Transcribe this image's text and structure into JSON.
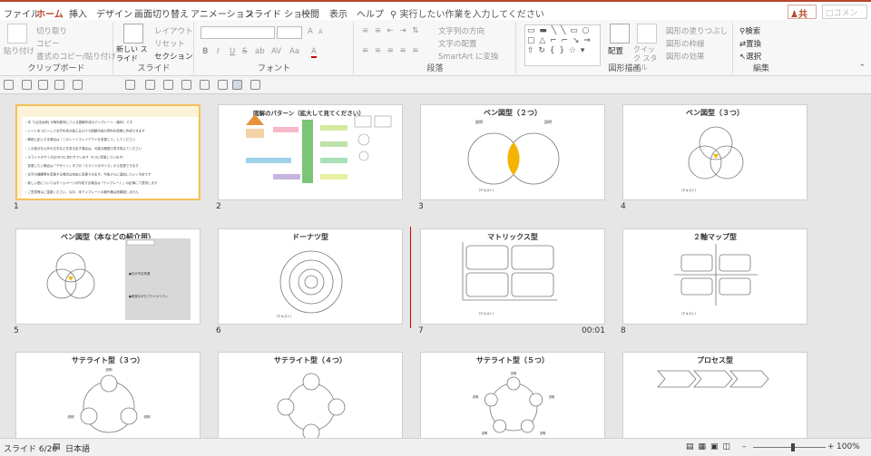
{
  "tabs": [
    {
      "name": "tab-file",
      "label": "ファイル"
    },
    {
      "name": "tab-home",
      "label": "ホーム",
      "active": true
    },
    {
      "name": "tab-insert",
      "label": "挿入"
    },
    {
      "name": "tab-design",
      "label": "デザイン"
    },
    {
      "name": "tab-transitions",
      "label": "画面切り替え"
    },
    {
      "name": "tab-animations",
      "label": "アニメーション"
    },
    {
      "name": "tab-slideshow",
      "label": "スライド ショー"
    },
    {
      "name": "tab-review",
      "label": "校閲"
    },
    {
      "name": "tab-view",
      "label": "表示"
    },
    {
      "name": "tab-help",
      "label": "ヘルプ"
    }
  ],
  "tell_me": "実行したい作業を入力してください",
  "share_label": "共有",
  "comment_label": "コメント",
  "ribbon": {
    "clipboard": {
      "label": "クリップボード",
      "paste": "貼り付け",
      "cut": "切り取り",
      "copy": "コピー",
      "format_painter": "書式のコピー/貼り付け"
    },
    "slides": {
      "label": "スライド",
      "new_slide": "新しい スライド",
      "layout": "レイアウト",
      "reset": "リセット",
      "section": "セクション"
    },
    "font": {
      "label": "フォント",
      "bold": "B",
      "italic": "I",
      "underline": "U",
      "strike": "S",
      "shadow": "ab",
      "spacing": "AV",
      "case": "Aa",
      "font_color": "A",
      "grow": "A",
      "shrink": "A"
    },
    "paragraph": {
      "label": "段落",
      "text_direction": "文字列の方向",
      "align_text": "文字の配置",
      "smartart": "SmartArt に変換"
    },
    "drawing": {
      "label": "図形描画",
      "shapes_preview": "▭ ▬ ╲ ╲ ▭ ○\n▢ △ ⌐ ⌐ ↘ ⇒\n⇧ ↻ { } ☆ ▾",
      "arrange": "配置",
      "quick_styles": "クイック スタイル",
      "shape_fill": "図形の塗りつぶし",
      "shape_outline": "図形の枠線",
      "shape_effects": "図形の効果"
    },
    "editing": {
      "label": "編集",
      "find": "検索",
      "replace": "置換",
      "select": "選択"
    }
  },
  "slides": [
    {
      "num": "1",
      "title": "このテンプレートについて",
      "type": "text",
      "selected": true,
      "lines": [
        "・本「[山田太郎] が無料配布している図解作成のテンプレート（無料）です",
        "・シートをコピーして文字を書き換えるだけで図解作成の資料を簡単に作成できます",
        "・解説に記入する場合は「このシートでレイアウトを変更して」してください",
        "・この部分を以外の文字などを書き足す場合は、可能な範囲で書き換えてください",
        "・スライドのサイズは16:9に合わせています（4:3に変換しています）",
        "　変更したい場合は「デザイン」タブの「スライドのサイズ」から変更できます",
        "・文字の種類等を変更する場合は自由に変更できます。今後さらに追加していく予定です",
        "・新しい図についてはホームページの作成する場合は「テンプレート」の記事にて提供します",
        "・ご意見等はご遠慮ください。なお、本テンプレートの著作権は放棄致しません"
      ]
    },
    {
      "num": "2",
      "title": "図解のパターン（拡大して見てください）",
      "type": "overview"
    },
    {
      "num": "3",
      "title": "ベン図型（２つ）",
      "type": "venn2",
      "labels": [
        "説明",
        "説明"
      ],
      "foot": "（テキスト）"
    },
    {
      "num": "4",
      "title": "ベン図型（３つ）",
      "type": "venn3",
      "foot": "（テキスト）"
    },
    {
      "num": "5",
      "title": "ベン図型（本などの紹介用）",
      "type": "venn-book",
      "items": [
        "●次が予定資源",
        "●着実ながらプライオリティ"
      ]
    },
    {
      "num": "6",
      "title": "ドーナツ型",
      "type": "donut",
      "foot": "（テキスト）"
    },
    {
      "num": "7",
      "title": "マトリックス型",
      "type": "matrix",
      "foot": "（テキスト）",
      "time": "00:01"
    },
    {
      "num": "8",
      "title": "２軸マップ型",
      "type": "axis",
      "foot": "（テキスト）"
    },
    {
      "num": "9",
      "title": "サテライト型（３つ）",
      "type": "sat3",
      "labels": [
        "説明",
        "説明",
        "説明"
      ]
    },
    {
      "num": "10",
      "title": "サテライト型（４つ）",
      "type": "sat4"
    },
    {
      "num": "11",
      "title": "サテライト型（５つ）",
      "type": "sat5",
      "labels": [
        "説明",
        "説明",
        "説明",
        "説明",
        "説明"
      ]
    },
    {
      "num": "12",
      "title": "プロセス型",
      "type": "process"
    }
  ],
  "status": {
    "slide": "スライド 6/20",
    "language": "日本語",
    "zoom": "100%",
    "zoom_level": 1.0
  },
  "colors": {
    "accent": "#b7472a",
    "highlight": "#f4c15d",
    "venn_fill": "#f5b400"
  }
}
